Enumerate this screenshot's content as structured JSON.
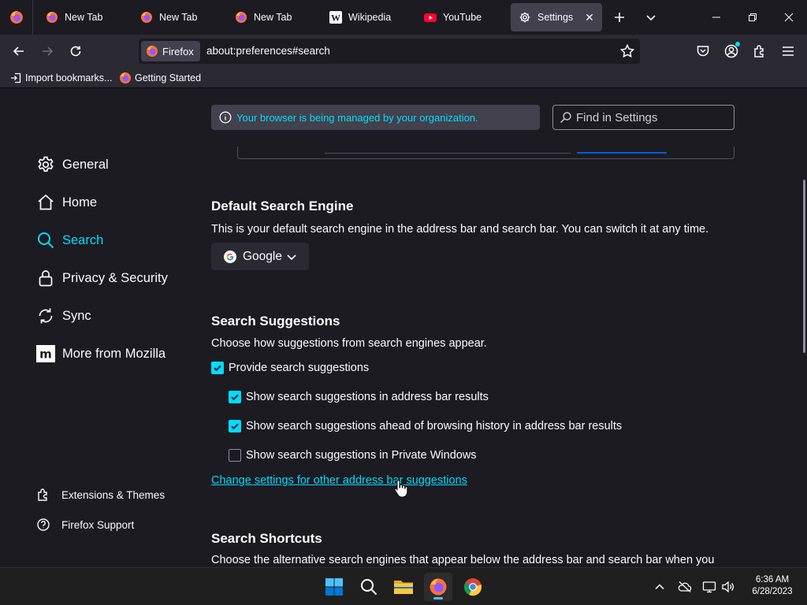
{
  "tabs": [
    {
      "label": "New Tab",
      "icon": "firefox-icon"
    },
    {
      "label": "New Tab",
      "icon": "firefox-icon"
    },
    {
      "label": "New Tab",
      "icon": "firefox-icon"
    },
    {
      "label": "Wikipedia",
      "icon": "wikipedia-icon"
    },
    {
      "label": "YouTube",
      "icon": "youtube-icon"
    },
    {
      "label": "Settings",
      "icon": "gear-icon",
      "active": true
    }
  ],
  "urlbar": {
    "identity_label": "Firefox",
    "url": "about:preferences#search"
  },
  "bookmarks": [
    {
      "label": "Import bookmarks...",
      "icon": "import-icon"
    },
    {
      "label": "Getting Started",
      "icon": "firefox-icon"
    }
  ],
  "managed_notice": "Your browser is being managed by your organization.",
  "find_placeholder": "Find in Settings",
  "sidebar": {
    "categories": [
      {
        "label": "General",
        "icon": "gear-icon"
      },
      {
        "label": "Home",
        "icon": "home-icon"
      },
      {
        "label": "Search",
        "icon": "search-icon",
        "selected": true
      },
      {
        "label": "Privacy & Security",
        "icon": "lock-icon"
      },
      {
        "label": "Sync",
        "icon": "sync-icon"
      },
      {
        "label": "More from Mozilla",
        "icon": "mozilla-icon"
      }
    ],
    "footer_links": [
      {
        "label": "Extensions & Themes",
        "icon": "puzzle-icon"
      },
      {
        "label": "Firefox Support",
        "icon": "help-icon"
      }
    ]
  },
  "default_engine": {
    "heading": "Default Search Engine",
    "description": "This is your default search engine in the address bar and search bar. You can switch it at any time.",
    "selected": "Google"
  },
  "suggestions": {
    "heading": "Search Suggestions",
    "description": "Choose how suggestions from search engines appear.",
    "options": [
      {
        "label": "Provide search suggestions",
        "checked": true
      },
      {
        "label": "Show search suggestions in address bar results",
        "checked": true
      },
      {
        "label": "Show search suggestions ahead of browsing history in address bar results",
        "checked": true
      },
      {
        "label": "Show search suggestions in Private Windows",
        "checked": false
      }
    ],
    "link": "Change settings for other address bar suggestions"
  },
  "shortcuts": {
    "heading": "Search Shortcuts",
    "description": "Choose the alternative search engines that appear below the address bar and search bar when you"
  },
  "taskbar": {
    "time": "6:36 AM",
    "date": "6/28/2023"
  },
  "colors": {
    "accent": "#00ddff",
    "background": "#1c1b22",
    "toolbar": "#2b2a33"
  }
}
